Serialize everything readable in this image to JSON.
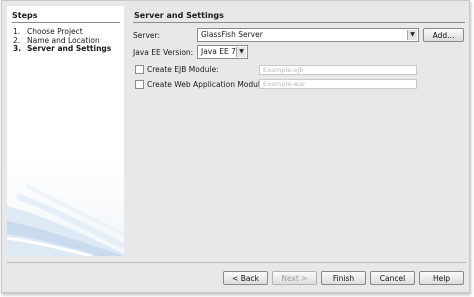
{
  "steps": {
    "title": "Steps",
    "items": [
      {
        "num": "1.",
        "label": "Choose Project"
      },
      {
        "num": "2.",
        "label": "Name and Location"
      },
      {
        "num": "3.",
        "label": "Server and Settings"
      }
    ]
  },
  "content": {
    "title": "Server and Settings",
    "server_label": "Server:",
    "server_value": "GlassFish Server",
    "add_button": "Add...",
    "javaee_label": "Java EE Version:",
    "javaee_value": "Java EE 7",
    "ejb_checkbox_label": "Create EJB Module:",
    "ejb_placeholder": "Example-ejb",
    "web_checkbox_label": "Create Web Application Module:",
    "web_placeholder": "Example-war"
  },
  "buttons": {
    "back": "< Back",
    "next": "Next >",
    "finish": "Finish",
    "cancel": "Cancel",
    "help": "Help"
  },
  "colors": {
    "window_bg": "#e8e8e8",
    "steps_bg": "#ffffff",
    "swoosh": "#c9dcef"
  }
}
